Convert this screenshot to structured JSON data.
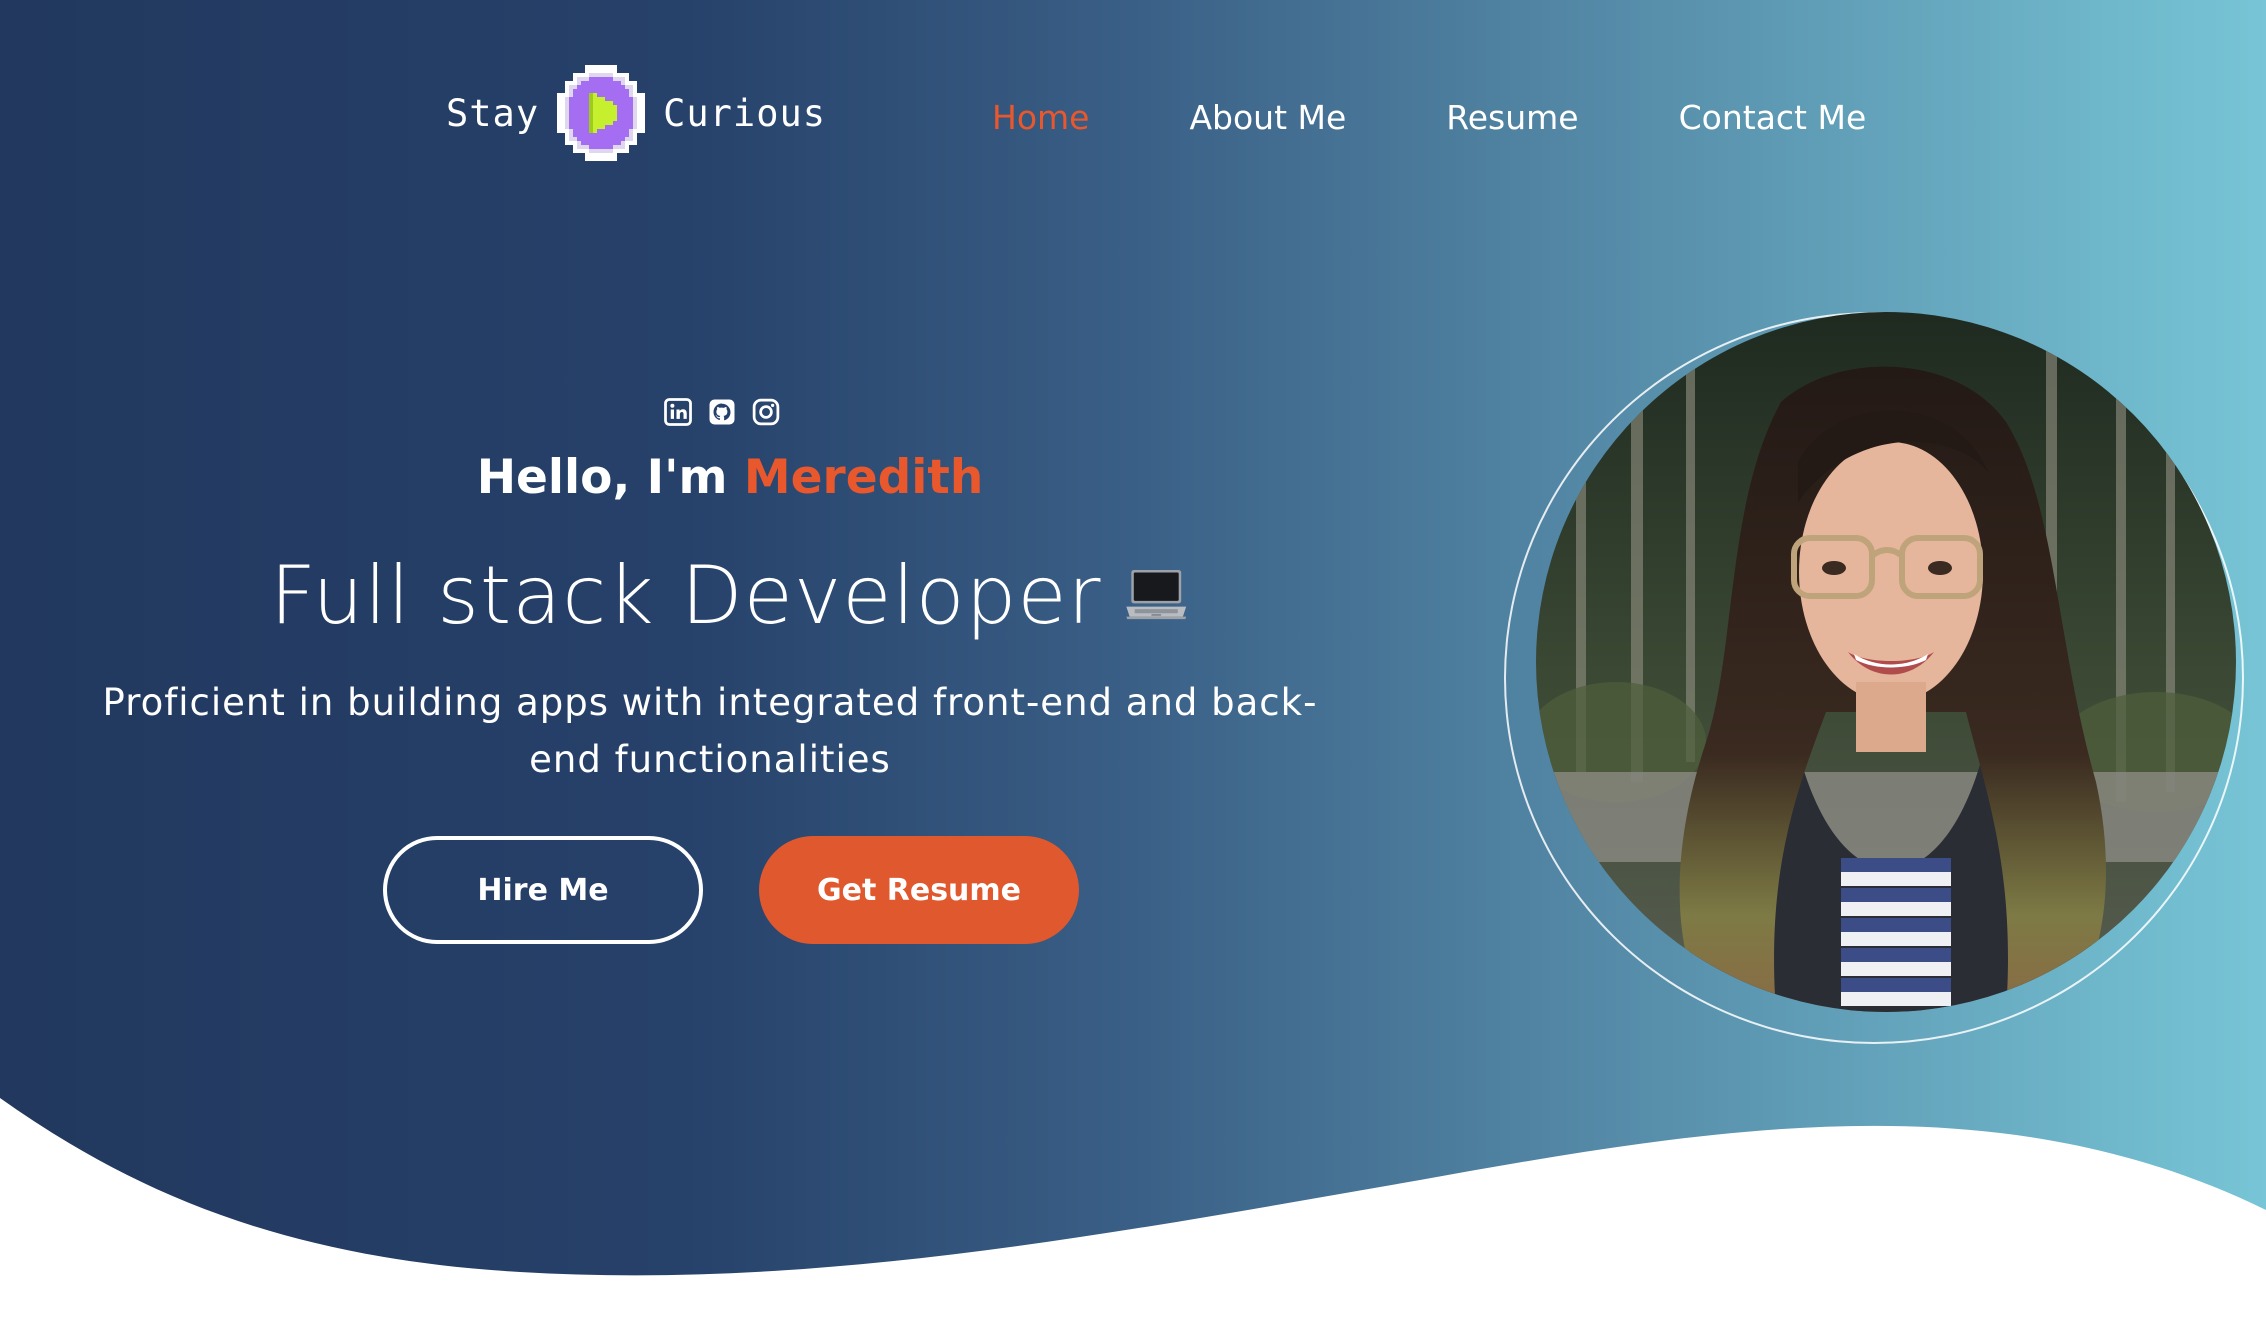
{
  "brand": {
    "left_word": "Stay",
    "right_word": "Curious",
    "badge_colors": {
      "ring": "#ffffff",
      "disc": "#a56ef2",
      "play": "#c6ef2e"
    }
  },
  "nav": {
    "items": [
      {
        "label": "Home",
        "active": true
      },
      {
        "label": "About Me",
        "active": false
      },
      {
        "label": "Resume",
        "active": false
      },
      {
        "label": "Contact Me",
        "active": false
      }
    ]
  },
  "socials": [
    {
      "icon": "linkedin-icon"
    },
    {
      "icon": "github-icon"
    },
    {
      "icon": "instagram-icon"
    }
  ],
  "hero": {
    "greeting_prefix": "Hello, I'm",
    "name": "Meredith",
    "role": "Full stack Developer",
    "role_icon": "laptop-icon",
    "description": "Proficient in building apps with integrated front-end and back-end functionalities",
    "hire_button": "Hire Me",
    "resume_button": "Get Resume"
  },
  "profile_photo": {
    "icon": "profile-photo"
  },
  "colors": {
    "accent": "#e8582c",
    "button_orange": "#e0582d",
    "gradient_start": "#22385e",
    "gradient_end": "#77c5d6",
    "text": "#ffffff"
  }
}
